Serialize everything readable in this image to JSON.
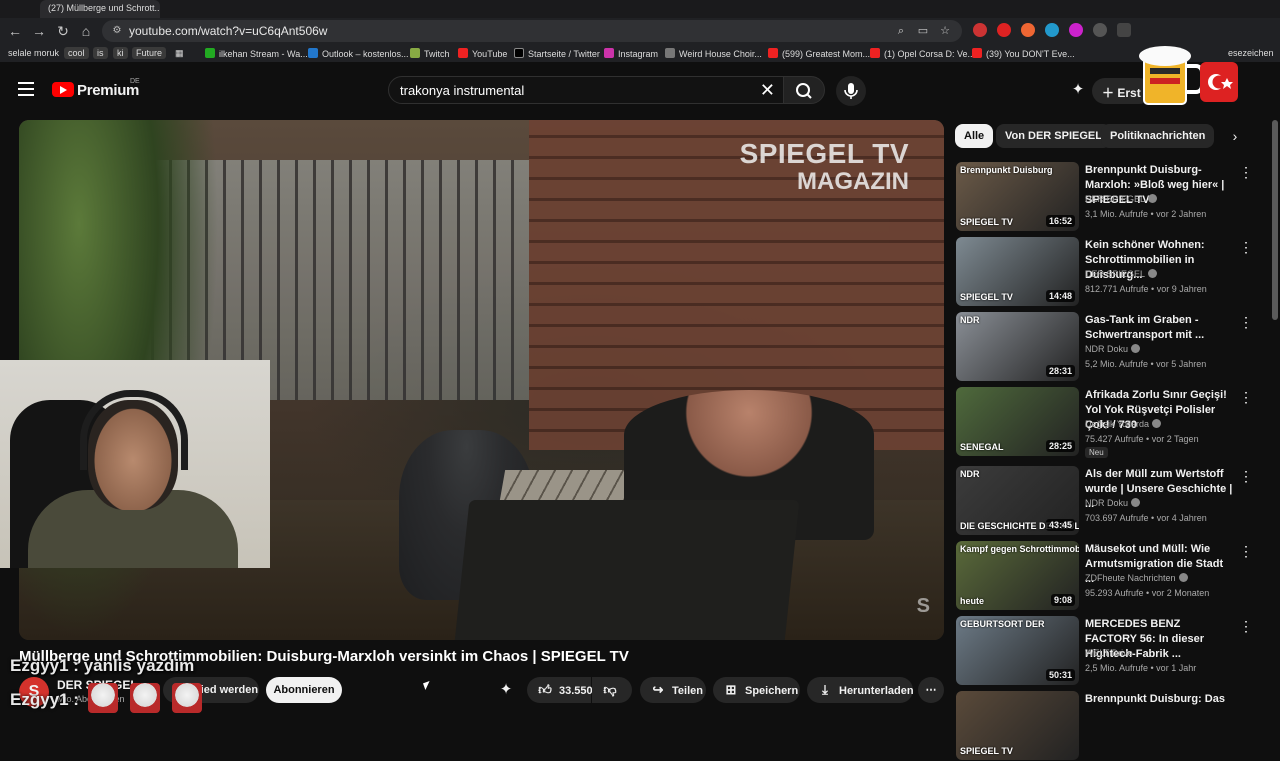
{
  "browser": {
    "tab_title": "(27) Müllberge und Schrott...",
    "url": "youtube.com/watch?v=uC6qAnt506w",
    "bookmarks": [
      "selale moruk",
      "cool",
      "is",
      "ki",
      "Future",
      "ilkehan Stream - Wa...",
      "Outlook – kostenlos...",
      "Twitch",
      "YouTube",
      "Startseite / Twitter",
      "Instagram",
      "Weird House Choir...",
      "(599) Greatest Mom...",
      "(1) Opel Corsa D: Ve...",
      "(39) You DON'T Eve...",
      "esezeichen"
    ]
  },
  "header": {
    "logo_text": "Premium",
    "country_code": "DE",
    "search_query": "trakonya instrumental",
    "create_label": "Erst"
  },
  "video": {
    "overlay_logo_line1": "SPIEGEL TV",
    "overlay_logo_line2": "MAGAZIN",
    "corner_mark": "S",
    "title": "Müllberge und Schrottimmobilien: Duisburg-Marxloh versinkt im Chaos | SPIEGEL TV",
    "channel_avatar_letter": "S",
    "channel_name": "DER SPIEGEL",
    "subscriber_text": "Mio. Abonnenten",
    "member_label": "Mitglied werden",
    "subscribe_label": "Abonnieren",
    "like_count": "33.550",
    "share_label": "Teilen",
    "save_label": "Speichern",
    "download_label": "Herunterladen"
  },
  "chat": {
    "line1": "Ezgyy1 : yanlis yazdim",
    "line2": "Ezgyy1 :"
  },
  "chips": [
    "Alle",
    "Von DER SPIEGEL",
    "Politiknachrichten"
  ],
  "recommendations": [
    {
      "title": "Brennpunkt Duisburg-Marxloh: »Bloß weg hier« | SPIEGEL TV",
      "channel": "DER SPIEGEL",
      "meta": "3,1 Mio. Aufrufe • vor 2 Jahren",
      "duration": "16:52",
      "thumb_label": "SPIEGEL TV",
      "thumb_top": "Brennpunkt Duisburg",
      "thumb_color": "#6b5a48",
      "verified": true,
      "badge": ""
    },
    {
      "title": "Kein schöner Wohnen: Schrottimmobilien in Duisburg...",
      "channel": "DER SPIEGEL",
      "meta": "812.771 Aufrufe • vor 9 Jahren",
      "duration": "14:48",
      "thumb_label": "SPIEGEL TV",
      "thumb_top": "",
      "thumb_color": "#7e8a92",
      "verified": true,
      "badge": ""
    },
    {
      "title": "Gas-Tank im Graben - Schwertransport mit ...",
      "channel": "NDR Doku",
      "meta": "5,2 Mio. Aufrufe • vor 5 Jahren",
      "duration": "28:31",
      "thumb_label": "",
      "thumb_top": "NDR",
      "thumb_color": "#8a8f96",
      "verified": true,
      "badge": ""
    },
    {
      "title": "Afrikada Zorlu Sınır Geçişi! Yol Yok Rüşvetçi Polisler Çok! / 730",
      "channel": "Değişik Yollarda",
      "meta": "75.427 Aufrufe • vor 2 Tagen",
      "duration": "28:25",
      "thumb_label": "SENEGAL",
      "thumb_top": "",
      "thumb_color": "#4f6a3c",
      "verified": true,
      "badge": "Neu"
    },
    {
      "title": "Als der Müll zum Wertstoff wurde | Unsere Geschichte | ...",
      "channel": "NDR Doku",
      "meta": "703.697 Aufrufe • vor 4 Jahren",
      "duration": "43:45",
      "thumb_label": "DIE GESCHICHTE DER MÜLLABFUHR",
      "thumb_top": "NDR",
      "thumb_color": "#3c3c3c",
      "verified": true,
      "badge": ""
    },
    {
      "title": "Mäusekot und Müll: Wie Armutsmigration die Stadt ...",
      "channel": "ZDFheute Nachrichten",
      "meta": "95.293 Aufrufe • vor 2 Monaten",
      "duration": "9:08",
      "thumb_label": "heute",
      "thumb_top": "Kampf gegen Schrottimmobilien und Sozialbetrug",
      "thumb_color": "#5a6a3a",
      "verified": true,
      "badge": ""
    },
    {
      "title": "MERCEDES BENZ FACTORY 56: In dieser Hightech-Fabrik ...",
      "channel": "WELT Drive",
      "meta": "2,5 Mio. Aufrufe • vor 1 Jahr",
      "duration": "50:31",
      "thumb_label": "",
      "thumb_top": "GEBURTSORT DER",
      "thumb_color": "#6c7a86",
      "verified": false,
      "badge": ""
    },
    {
      "title": "Brennpunkt Duisburg: Das",
      "channel": "",
      "meta": "",
      "duration": "",
      "thumb_label": "SPIEGEL TV",
      "thumb_top": "",
      "thumb_color": "#5a4a3a",
      "verified": false,
      "badge": ""
    }
  ],
  "colors": {
    "background": "#0f0f0f",
    "accent": "#ff0000",
    "chip_active": "#f1f1f1",
    "chip": "#272727"
  }
}
